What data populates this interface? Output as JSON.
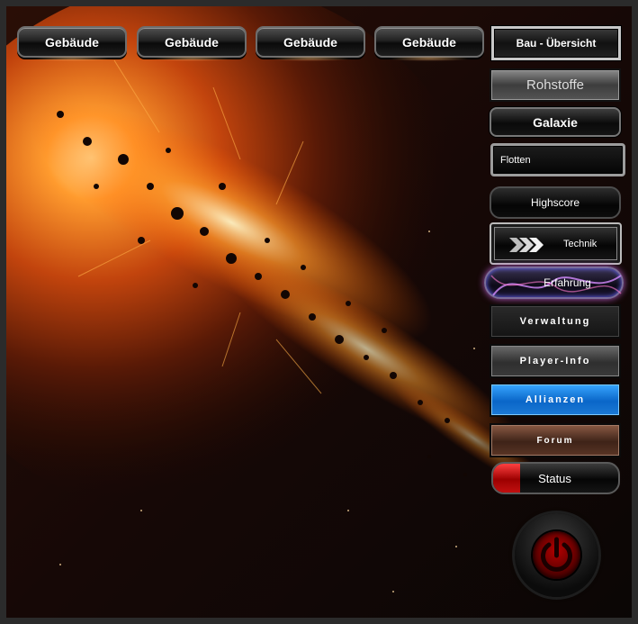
{
  "top_nav": [
    {
      "label": "Gebäude"
    },
    {
      "label": "Gebäude"
    },
    {
      "label": "Gebäude"
    },
    {
      "label": "Gebäude"
    }
  ],
  "side_menu": {
    "bau_uebersicht": "Bau - Übersicht",
    "rohstoffe": "Rohstoffe",
    "galaxie": "Galaxie",
    "flotten": "Flotten",
    "highscore": "Highscore",
    "technik": "Technik",
    "erfahrung": "Erfahrung",
    "verwaltung": "Verwaltung",
    "player_info": "Player-Info",
    "allianzen": "Allianzen",
    "forum": "Forum",
    "status": "Status"
  },
  "icons": {
    "technik_icon": "chevron-arrows-icon",
    "power_icon": "power-icon"
  },
  "colors": {
    "allianzen_accent": "#0a66c8",
    "status_indicator": "#c21010",
    "power_ring": "#b30000",
    "erfahrung_glow": "#b65cc8"
  }
}
